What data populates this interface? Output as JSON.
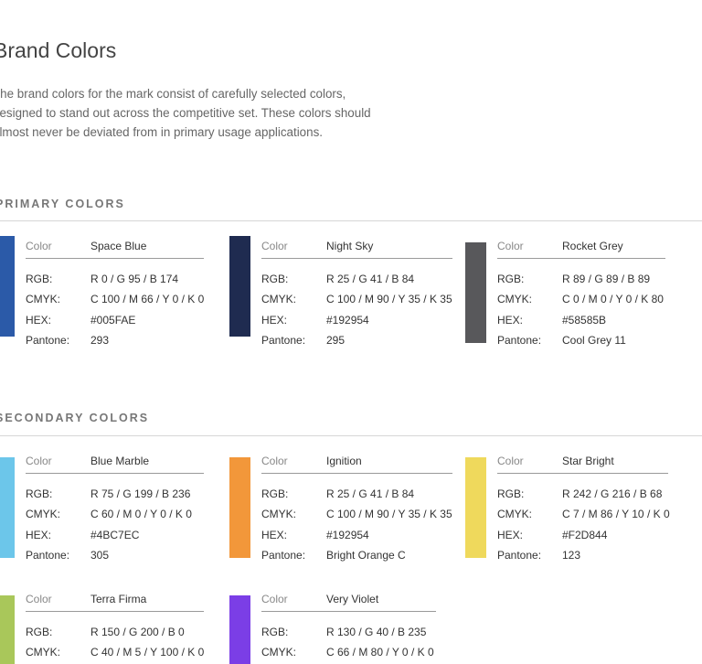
{
  "title": "Brand Colors",
  "intro": "The brand colors for the mark consist of carefully selected colors, designed to stand out across the competitive set. These colors should almost never be deviated from in primary usage applications.",
  "field_labels": {
    "color": "Color",
    "rgb": "RGB:",
    "cmyk": "CMYK:",
    "hex": "HEX:",
    "pantone": "Pantone:"
  },
  "primary": {
    "heading": "PRIMARY COLORS",
    "colors": [
      {
        "name": "Space Blue",
        "rgb": "R 0 / G 95 / B 174",
        "cmyk": "C 100 / M 66 / Y 0 / K 0",
        "hex": "#005FAE",
        "pantone": "293",
        "swatch": "#2b5aa8"
      },
      {
        "name": "Night Sky",
        "rgb": "R 25 / G 41 / B 84",
        "cmyk": "C 100 / M 90 / Y 35 / K 35",
        "hex": "#192954",
        "pantone": "295",
        "swatch": "#1f2b50"
      },
      {
        "name": "Rocket Grey",
        "rgb": "R 89 / G 89 / B 89",
        "cmyk": "C 0 / M 0 / Y 0 / K 80",
        "hex": "#58585B",
        "pantone": "Cool Grey 11",
        "swatch": "#58585b"
      }
    ]
  },
  "secondary": {
    "heading": "SECONDARY COLORS",
    "colors": [
      {
        "name": "Blue Marble",
        "rgb": "R 75 / G 199 / B 236",
        "cmyk": "C 60 / M 0 / Y 0 / K 0",
        "hex": "#4BC7EC",
        "pantone": "305",
        "swatch": "#6cc6ea"
      },
      {
        "name": "Ignition",
        "rgb": "R 25 / G 41 / B 84",
        "cmyk": "C 100 / M 90 / Y 35 / K 35",
        "hex": "#192954",
        "pantone": "Bright Orange C",
        "swatch": "#f2973a"
      },
      {
        "name": "Star Bright",
        "rgb": "R 242 / G 216 / B 68",
        "cmyk": "C 7 / M 86 / Y 10 / K 0",
        "hex": "#F2D844",
        "pantone": "123",
        "swatch": "#efd95c"
      },
      {
        "name": "Terra Firma",
        "rgb": "R 150 / G 200 / B 0",
        "cmyk": "C 40 / M 5 / Y 100 / K 0",
        "hex": "",
        "pantone": "",
        "swatch": "#a9c75a"
      },
      {
        "name": "Very Violet",
        "rgb": "R 130 / G 40 / B 235",
        "cmyk": "C 66 / M 80 / Y 0 / K 0",
        "hex": "",
        "pantone": "",
        "swatch": "#7b3ee6"
      }
    ]
  }
}
